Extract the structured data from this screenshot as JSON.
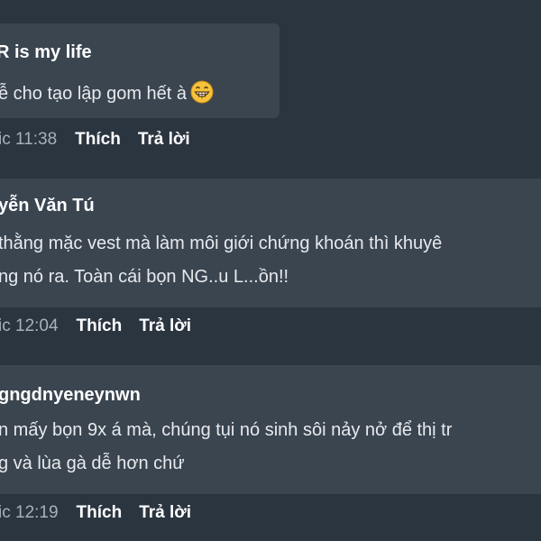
{
  "comments": [
    {
      "author": "R is my life",
      "lines": [
        "ễ cho tạo lập gom hết à"
      ],
      "emoji": "grinning-face-icon",
      "time": "ic 11:38",
      "like_label": "Thích",
      "reply_label": "Trả lời"
    },
    {
      "author": "yễn Văn Tú",
      "lines": [
        "thằng mặc vest mà làm môi giới chứng khoán thì khuyê",
        "ng nó ra. Toàn cái bọn NG..u L...ồn!!"
      ],
      "time": "ic 12:04",
      "like_label": "Thích",
      "reply_label": "Trả lời"
    },
    {
      "author": "gngdnyeneynwn",
      "lines": [
        "n mấy bọn 9x á mà, chúng tụi nó sinh sôi nảy nở để thị tr",
        "g và lùa gà dễ hơn chứ"
      ],
      "time": "ic 12:19",
      "like_label": "Thích",
      "reply_label": "Trả lời"
    }
  ],
  "colors": {
    "background": "#2b3540",
    "bubble": "#3a4550",
    "text": "#e8eaed",
    "muted": "#a9b0b8"
  }
}
